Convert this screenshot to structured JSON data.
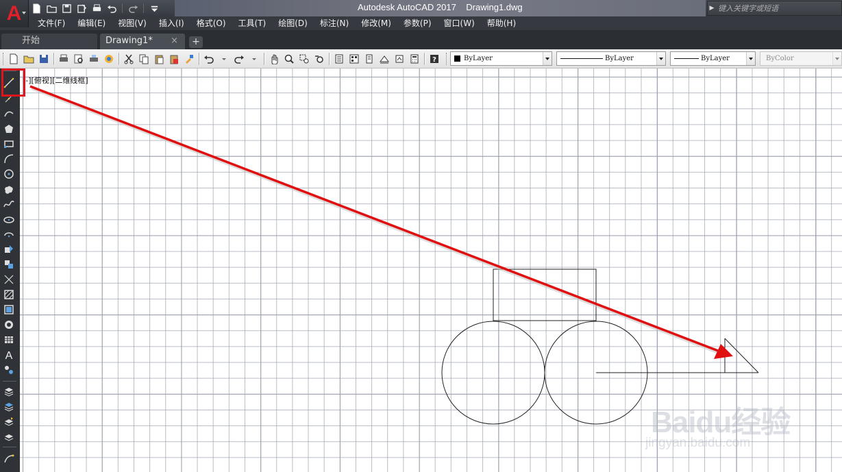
{
  "titlebar": {
    "title": "Autodesk AutoCAD 2017    Drawing1.dwg",
    "search_placeholder": "键入关键字或短语",
    "app_logo": "A"
  },
  "quick_access": [
    "new-icon",
    "open-icon",
    "save-icon",
    "save-as-icon",
    "plot-icon",
    "undo-icon",
    "redo-icon",
    "customize-icon"
  ],
  "menu": [
    "文件(F)",
    "编辑(E)",
    "视图(V)",
    "插入(I)",
    "格式(O)",
    "工具(T)",
    "绘图(D)",
    "标注(N)",
    "修改(M)",
    "参数(P)",
    "窗口(W)",
    "帮助(H)"
  ],
  "tabs": {
    "start": "开始",
    "drawing": "Drawing1*",
    "close": "×",
    "add": "+"
  },
  "properties": {
    "color": "ByLayer",
    "linetype": "ByLayer",
    "lineweight": "ByLayer",
    "plotstyle": "ByColor"
  },
  "viewport_label": "[-][俯视][二维线框]",
  "watermark": {
    "brand": "Baidu经验",
    "url": "jingyan.baidu.com"
  },
  "colors": {
    "highlight": "#e0141b",
    "arrow": "#e01010",
    "autocad_red": "#e0202a",
    "dark_chrome": "#363a40"
  }
}
